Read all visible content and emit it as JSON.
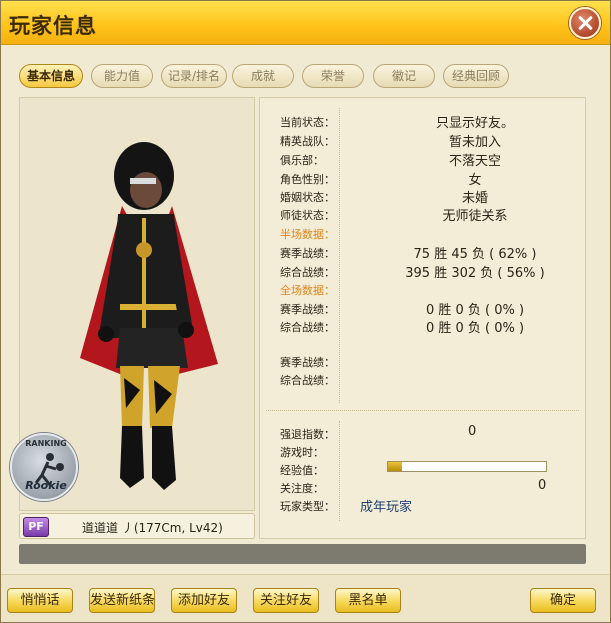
{
  "window": {
    "title": "玩家信息"
  },
  "tabs": [
    {
      "label": "基本信息",
      "active": true
    },
    {
      "label": "能力值",
      "active": false
    },
    {
      "label": "记录/排名",
      "active": false
    },
    {
      "label": "成就",
      "active": false
    },
    {
      "label": "荣誉",
      "active": false
    },
    {
      "label": "徽记",
      "active": false
    },
    {
      "label": "经典回顾",
      "active": false
    }
  ],
  "badge": {
    "top": "RANKING",
    "bottom": "Rookie"
  },
  "player": {
    "badge": "PF",
    "name": "道道道 丿(177Cm, Lv42)"
  },
  "info": {
    "status_label": "当前状态：",
    "status_value": "只显示好友。",
    "team_label": "精英战队：",
    "team_value": "暂未加入",
    "club_label": "俱乐部：",
    "club_value": "不落天空",
    "gender_label": "角色性别：",
    "gender_value": "女",
    "marriage_label": "婚姻状态：",
    "marriage_value": "未婚",
    "mentor_label": "师徒状态：",
    "mentor_value": "无师徒关系",
    "half_section": "半场数据：",
    "half_season_label": "赛季战绩：",
    "half_season_value": "75  胜  45  负  (  62%  )",
    "half_total_label": "综合战绩：",
    "half_total_value": "395  胜  302  负  (  56%  )",
    "full_section": "全场数据：",
    "full_season_label": "赛季战绩：",
    "full_season_value": "0  胜  0  负  (   0%  )",
    "full_total_label": "综合战绩：",
    "full_total_value": "0  胜  0  负  (   0%  )",
    "extra_season_label": "赛季战绩：",
    "extra_total_label": "综合战绩："
  },
  "stats": {
    "quit_label": "强退指数：",
    "quit_value": "0",
    "playtime_label": "游戏时：",
    "exp_label": "经验值：",
    "exp_fraction": 0.09,
    "follow_label": "关注度：",
    "follow_value": "0",
    "type_label": "玩家类型：",
    "type_value": "成年玩家"
  },
  "buttons": {
    "whisper": "悄悄话",
    "send_note": "发送新纸条",
    "add_friend": "添加好友",
    "follow": "关注好友",
    "blacklist": "黑名单",
    "confirm": "确定"
  },
  "colors": {
    "accent": "#f5c842",
    "section_orange": "#e0851c",
    "player_type_blue": "#1f3f73"
  }
}
